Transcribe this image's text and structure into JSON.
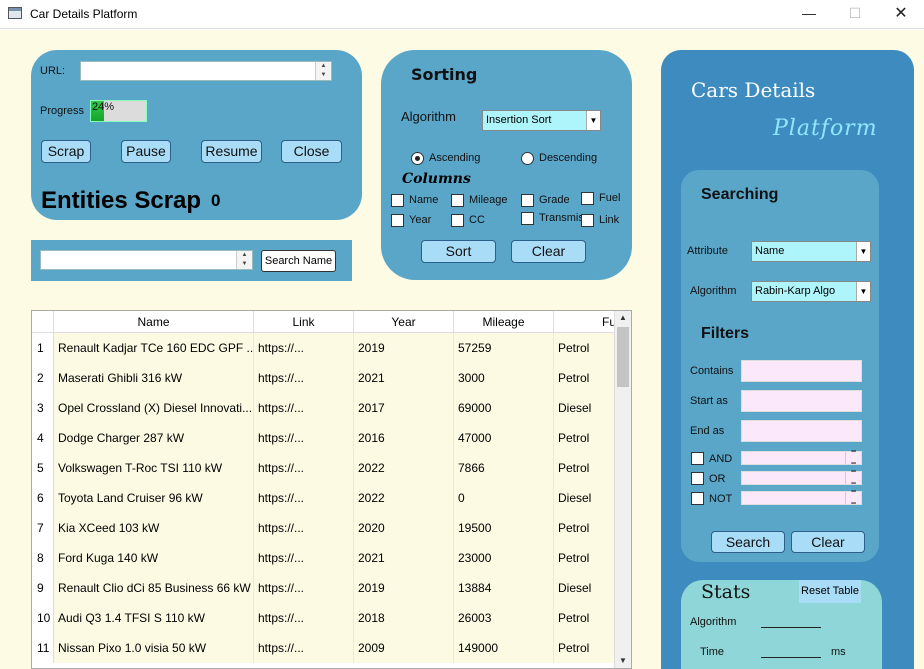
{
  "window": {
    "title": "Car Details Platform",
    "minimize": "—",
    "maximize": "☐",
    "close": "✕"
  },
  "scrap": {
    "url_label": "URL:",
    "url_value": "",
    "progress_label": "Progress",
    "progress_text": "24%",
    "progress_value": 24,
    "buttons": {
      "scrap": "Scrap",
      "pause": "Pause",
      "resume": "Resume",
      "close": "Close"
    },
    "entities_label": "Entities Scrap",
    "entities_count": "0"
  },
  "search_name": {
    "value": "",
    "button": "Search Name"
  },
  "sorting": {
    "title": "Sorting",
    "algorithm_label": "Algorithm",
    "algorithm_value": "Insertion Sort",
    "ascending": "Ascending",
    "descending": "Descending",
    "columns_title": "Columns",
    "columns": {
      "name": "Name",
      "mileage": "Mileage",
      "grade": "Grade",
      "fuel": "Fuel",
      "year": "Year",
      "cc": "CC",
      "transmis": "Transmis",
      "link": "Link"
    },
    "sort_button": "Sort",
    "clear_button": "Clear"
  },
  "brand": {
    "line1": "Cars Details",
    "line2": "Platform"
  },
  "searching": {
    "title": "Searching",
    "attribute_label": "Attribute",
    "attribute_value": "Name",
    "algorithm_label": "Algorithm",
    "algorithm_value": "Rabin-Karp Algo"
  },
  "filters": {
    "title": "Filters",
    "contains": "Contains",
    "start_as": "Start as",
    "end_as": "End as",
    "and": "AND",
    "or": "OR",
    "not": "NOT",
    "search_button": "Search",
    "clear_button": "Clear"
  },
  "stats": {
    "title": "Stats",
    "reset_button": "Reset Table",
    "algorithm_label": "Algorithm",
    "time_label": "Time",
    "time_unit": "ms"
  },
  "table": {
    "columns": [
      "Name",
      "Link",
      "Year",
      "Mileage",
      "Fuel"
    ],
    "rows": [
      {
        "num": "1",
        "name": "Renault Kadjar TCe 160 EDC GPF ...",
        "link": "https://...",
        "year": "2019",
        "mileage": "57259",
        "fuel": "Petrol"
      },
      {
        "num": "2",
        "name": "Maserati Ghibli 316 kW",
        "link": "https://...",
        "year": "2021",
        "mileage": "3000",
        "fuel": "Petrol"
      },
      {
        "num": "3",
        "name": "Opel Crossland (X) Diesel Innovati...",
        "link": "https://...",
        "year": "2017",
        "mileage": "69000",
        "fuel": "Diesel"
      },
      {
        "num": "4",
        "name": "Dodge Charger 287 kW",
        "link": "https://...",
        "year": "2016",
        "mileage": "47000",
        "fuel": "Petrol"
      },
      {
        "num": "5",
        "name": "Volkswagen T-Roc TSI 110 kW",
        "link": "https://...",
        "year": "2022",
        "mileage": "7866",
        "fuel": "Petrol"
      },
      {
        "num": "6",
        "name": "Toyota Land Cruiser 96 kW",
        "link": "https://...",
        "year": "2022",
        "mileage": "0",
        "fuel": "Diesel"
      },
      {
        "num": "7",
        "name": "Kia XCeed 103 kW",
        "link": "https://...",
        "year": "2020",
        "mileage": "19500",
        "fuel": "Petrol"
      },
      {
        "num": "8",
        "name": "Ford Kuga 140 kW",
        "link": "https://...",
        "year": "2021",
        "mileage": "23000",
        "fuel": "Petrol"
      },
      {
        "num": "9",
        "name": "Renault Clio dCi 85 Business 66 kW",
        "link": "https://...",
        "year": "2019",
        "mileage": "13884",
        "fuel": "Diesel"
      },
      {
        "num": "10",
        "name": "Audi Q3 1.4 TFSI S 110 kW",
        "link": "https://...",
        "year": "2018",
        "mileage": "26003",
        "fuel": "Petrol"
      },
      {
        "num": "11",
        "name": "Nissan Pixo 1.0 visia 50 kW",
        "link": "https://...",
        "year": "2009",
        "mileage": "149000",
        "fuel": "Petrol"
      }
    ]
  }
}
